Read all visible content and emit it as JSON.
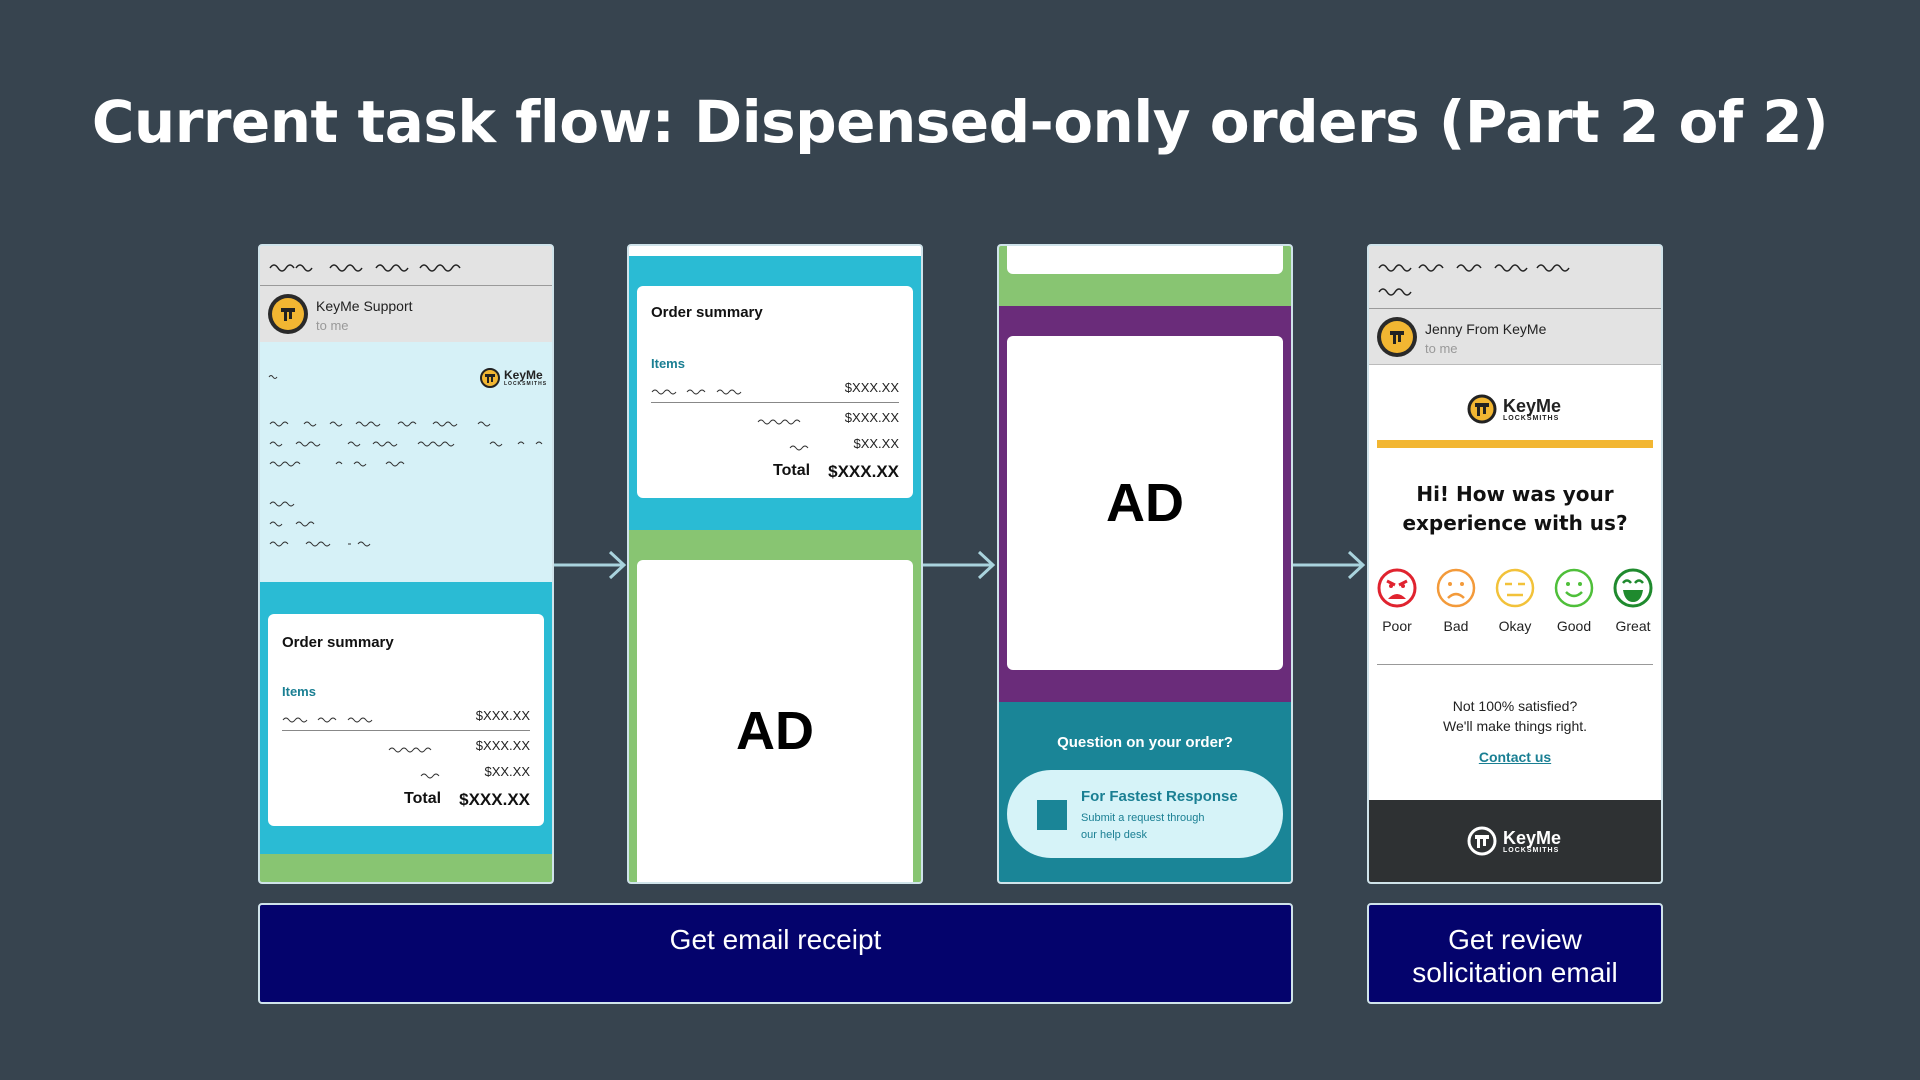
{
  "title": "Current task flow: Dispensed-only orders (Part 2 of 2)",
  "screen1": {
    "sender": "KeyMe Support",
    "to": "to me",
    "logo": "KeyMe",
    "logo_sub": "LOCKSMITHS",
    "order_summary": {
      "title": "Order summary",
      "items_label": "Items",
      "item_price": "$XXX.XX",
      "subtotal_1": "$XXX.XX",
      "subtotal_2": "$XX.XX",
      "total_label": "Total",
      "total_value": "$XXX.XX"
    }
  },
  "screen2": {
    "order_summary": {
      "title": "Order summary",
      "items_label": "Items",
      "item_price": "$XXX.XX",
      "subtotal_1": "$XXX.XX",
      "subtotal_2": "$XX.XX",
      "total_label": "Total",
      "total_value": "$XXX.XX"
    },
    "ad": "AD"
  },
  "screen3": {
    "ad": "AD",
    "question": "Question on your order?",
    "cta_title": "For Fastest Response",
    "cta_sub_1": "Submit a request through",
    "cta_sub_2": "our help desk"
  },
  "screen4": {
    "sender": "Jenny From KeyMe",
    "to": "to me",
    "logo": "KeyMe",
    "logo_sub": "LOCKSMITHS",
    "heading_1": "Hi! How was your",
    "heading_2": "experience with us?",
    "ratings": [
      "Poor",
      "Bad",
      "Okay",
      "Good",
      "Great"
    ],
    "not_satisfied_1": "Not 100% satisfied?",
    "not_satisfied_2": "We'll make things right.",
    "contact": "Contact us",
    "footer_logo": "KeyMe",
    "footer_logo_sub": "LOCKSMITHS"
  },
  "captions": {
    "left": "Get email receipt",
    "right_1": "Get review",
    "right_2": "solicitation email"
  },
  "colors": {
    "background": "#37444f",
    "caption_fill": "#04036c",
    "teal": "#2abbd4",
    "green": "#88c572",
    "purple": "#6a2c7a",
    "dark_teal": "#1a8597",
    "keyme_yellow": "#f2b632"
  }
}
